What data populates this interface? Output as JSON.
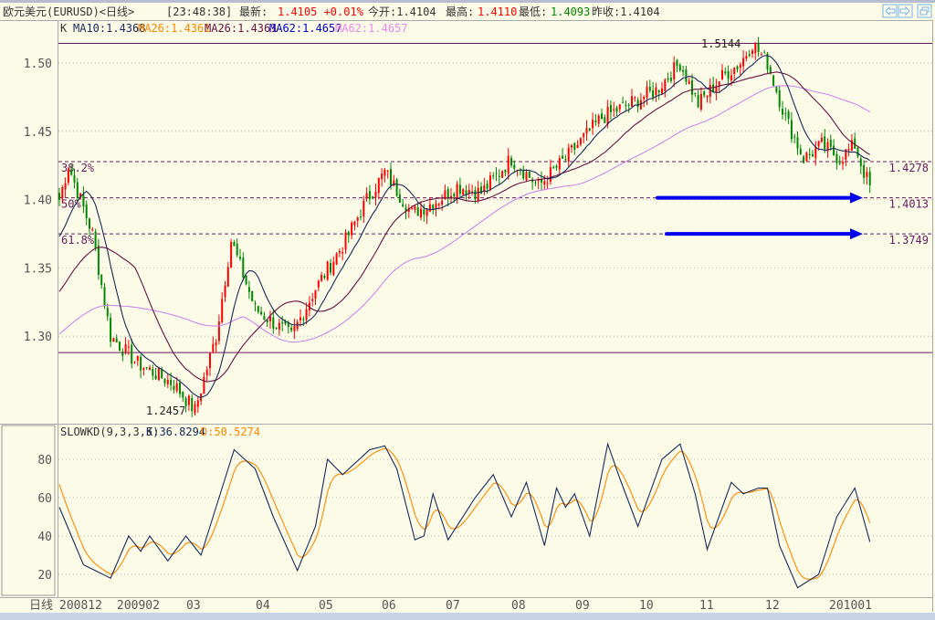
{
  "header": {
    "title": "欧元美元(EURUSD)<日线>",
    "time": "[23:48:38]",
    "latest_label": "最新:",
    "latest_value": "1.4105 +0.01%",
    "open_label": "今开:1.4104",
    "high_label": "最高:",
    "high_value": "1.4110",
    "low_label": "最低:",
    "low_value": "1.4093",
    "prev_close_label": "昨收:1.4104",
    "buttons": [
      "arrow-left-icon",
      "arrow-right-icon",
      "restore-window-icon"
    ]
  },
  "legend": {
    "k": "K",
    "ma10": "MA10:1.4368",
    "ma26a": "MA26:1.4361",
    "ma26b": "MA26:1.4361",
    "ma62a": "MA62:1.4657",
    "ma62b": "MA62:1.4657"
  },
  "colors": {
    "up": "#ff0000",
    "down": "#008800",
    "ma10": "#1a2a5a",
    "ma26": "#6a1040",
    "ma62": "#cc88ee",
    "k": "#1a2a5a",
    "d": "#ff8800",
    "arrow": "#0000ee",
    "fib": "#6a1a5a"
  },
  "chart_data": [
    {
      "type": "candlestick",
      "title": "欧元美元(EURUSD) 日线",
      "ylim": [
        1.23,
        1.53
      ],
      "y_ticks": [
        "1.50",
        "1.45",
        "1.40",
        "1.35",
        "1.30"
      ],
      "x_ticks": [
        "日线",
        "200812",
        "200902",
        "03",
        "04",
        "05",
        "06",
        "07",
        "08",
        "09",
        "10",
        "11",
        "12",
        "201001"
      ],
      "bars": 270,
      "close_anchors": [
        [
          0,
          1.4
        ],
        [
          3,
          1.425
        ],
        [
          11,
          1.375
        ],
        [
          17,
          1.3
        ],
        [
          26,
          1.28
        ],
        [
          38,
          1.265
        ],
        [
          45,
          1.2457
        ],
        [
          52,
          1.3
        ],
        [
          57,
          1.37
        ],
        [
          65,
          1.32
        ],
        [
          77,
          1.3
        ],
        [
          85,
          1.335
        ],
        [
          95,
          1.37
        ],
        [
          102,
          1.4
        ],
        [
          108,
          1.42
        ],
        [
          117,
          1.39
        ],
        [
          126,
          1.4
        ],
        [
          132,
          1.41
        ],
        [
          140,
          1.405
        ],
        [
          150,
          1.43
        ],
        [
          159,
          1.41
        ],
        [
          168,
          1.43
        ],
        [
          180,
          1.46
        ],
        [
          189,
          1.47
        ],
        [
          198,
          1.48
        ],
        [
          206,
          1.5
        ],
        [
          212,
          1.47
        ],
        [
          220,
          1.49
        ],
        [
          226,
          1.5
        ],
        [
          230,
          1.5144
        ],
        [
          235,
          1.5
        ],
        [
          241,
          1.46
        ],
        [
          247,
          1.43
        ],
        [
          253,
          1.44
        ],
        [
          259,
          1.43
        ],
        [
          264,
          1.44
        ],
        [
          267,
          1.42
        ],
        [
          269,
          1.4105
        ]
      ],
      "annotations": {
        "high": "1.5144",
        "low": "1.2457"
      },
      "horizontal_lines": [
        1.5144,
        1.288
      ],
      "fib_levels": [
        {
          "label": "38.2%",
          "value": "1.4278"
        },
        {
          "label": "50%",
          "value": "1.4013"
        },
        {
          "label": "61.8%",
          "value": "1.3749"
        }
      ],
      "arrows_at": [
        1.4013,
        1.3749
      ]
    },
    {
      "type": "line",
      "title": "SLOWKD(9,3,3,5)",
      "k_label": "K:36.8294",
      "d_label": "D:50.5274",
      "ylim": [
        5,
        95
      ],
      "y_ticks": [
        "80",
        "60",
        "40",
        "20"
      ],
      "k_anchors": [
        [
          0,
          55
        ],
        [
          8,
          25
        ],
        [
          17,
          18
        ],
        [
          23,
          40
        ],
        [
          27,
          32
        ],
        [
          30,
          40
        ],
        [
          36,
          27
        ],
        [
          42,
          40
        ],
        [
          47,
          30
        ],
        [
          53,
          60
        ],
        [
          58,
          85
        ],
        [
          65,
          75
        ],
        [
          71,
          50
        ],
        [
          79,
          22
        ],
        [
          85,
          45
        ],
        [
          89,
          80
        ],
        [
          94,
          72
        ],
        [
          103,
          85
        ],
        [
          108,
          87
        ],
        [
          112,
          75
        ],
        [
          118,
          38
        ],
        [
          121,
          40
        ],
        [
          124,
          62
        ],
        [
          129,
          38
        ],
        [
          138,
          60
        ],
        [
          144,
          72
        ],
        [
          150,
          50
        ],
        [
          155,
          68
        ],
        [
          161,
          35
        ],
        [
          165,
          65
        ],
        [
          168,
          55
        ],
        [
          171,
          62
        ],
        [
          176,
          40
        ],
        [
          182,
          88
        ],
        [
          186,
          70
        ],
        [
          192,
          45
        ],
        [
          200,
          80
        ],
        [
          206,
          88
        ],
        [
          211,
          62
        ],
        [
          215,
          33
        ],
        [
          223,
          68
        ],
        [
          227,
          62
        ],
        [
          232,
          65
        ],
        [
          235,
          65
        ],
        [
          239,
          35
        ],
        [
          245,
          13
        ],
        [
          252,
          20
        ],
        [
          258,
          50
        ],
        [
          264,
          65
        ],
        [
          269,
          37
        ]
      ]
    }
  ]
}
